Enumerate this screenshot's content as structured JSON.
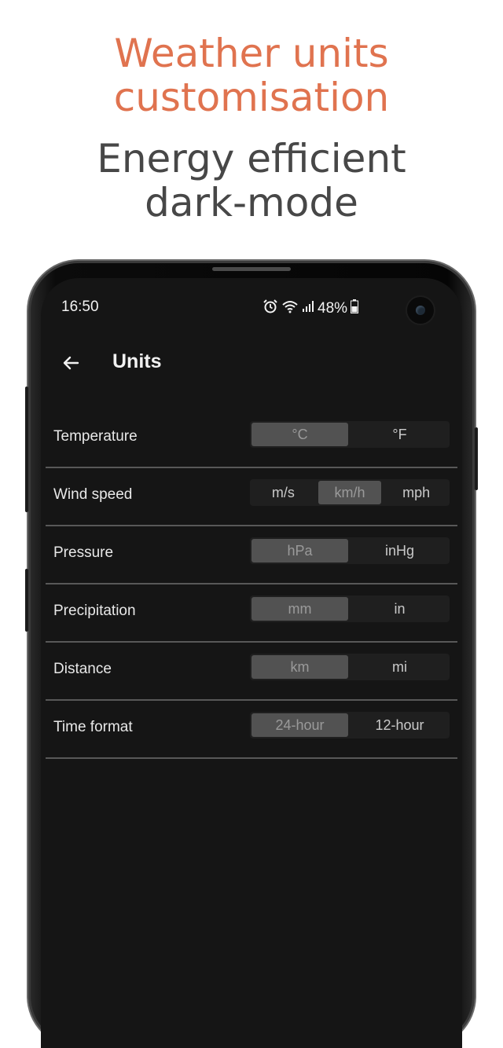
{
  "promo": {
    "accent_line_1": "Weather units",
    "accent_line_2": "customisation",
    "main_line_1": "Energy efficient",
    "main_line_2": "dark-mode"
  },
  "colors": {
    "accent": "#e0734f",
    "headline": "#474747",
    "screen_bg": "#151515",
    "segment_selected": "#525252"
  },
  "status_bar": {
    "time": "16:50",
    "battery": "48%",
    "icons": [
      "alarm-icon",
      "wifi-icon",
      "signal-icon",
      "battery-icon"
    ]
  },
  "app_bar": {
    "title": "Units",
    "back_icon": "arrow-left-icon"
  },
  "settings": {
    "rows": [
      {
        "label": "Temperature",
        "options": [
          "°C",
          "°F"
        ],
        "selected": 0
      },
      {
        "label": "Wind speed",
        "options": [
          "m/s",
          "km/h",
          "mph"
        ],
        "selected": 1
      },
      {
        "label": "Pressure",
        "options": [
          "hPa",
          "inHg"
        ],
        "selected": 0
      },
      {
        "label": "Precipitation",
        "options": [
          "mm",
          "in"
        ],
        "selected": 0
      },
      {
        "label": "Distance",
        "options": [
          "km",
          "mi"
        ],
        "selected": 0
      },
      {
        "label": "Time format",
        "options": [
          "24-hour",
          "12-hour"
        ],
        "selected": 0
      }
    ]
  }
}
